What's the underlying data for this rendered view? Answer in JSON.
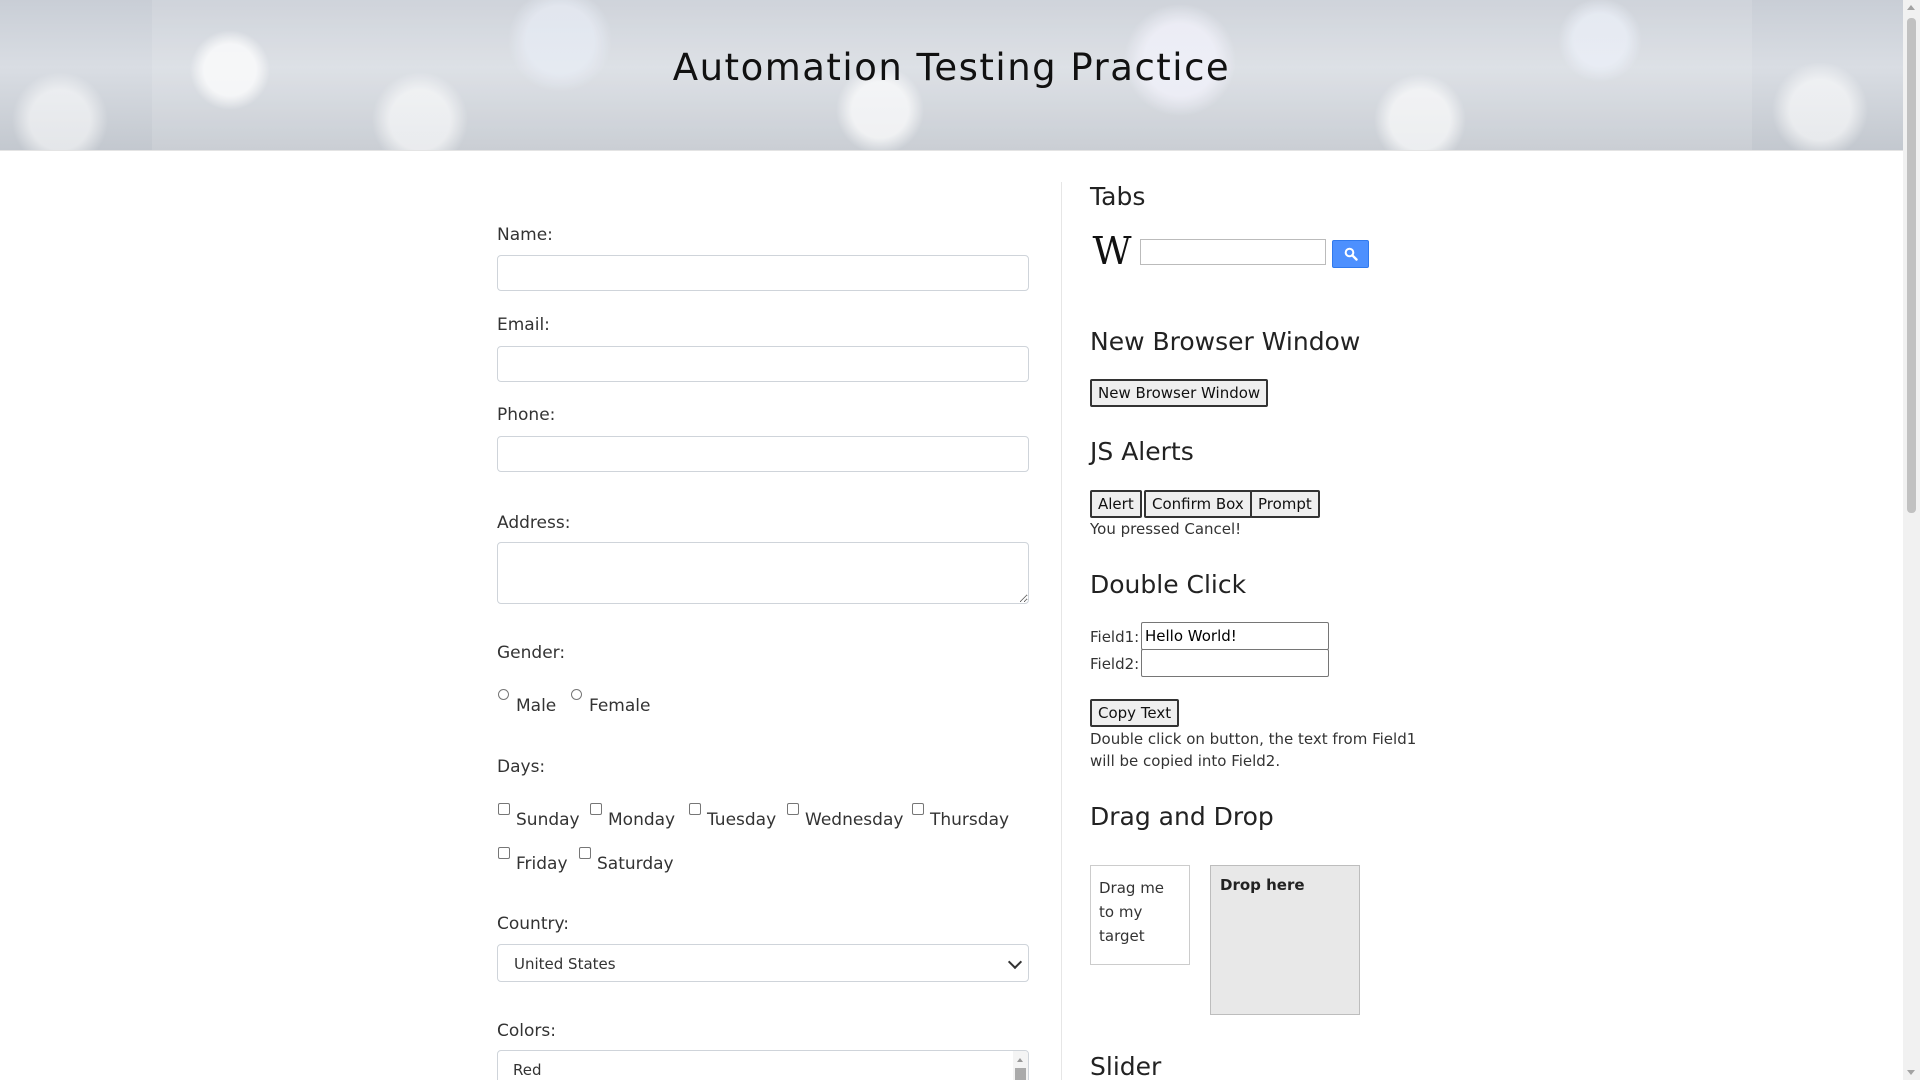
{
  "header": {
    "title": "Automation Testing Practice"
  },
  "form": {
    "name_label": "Name:",
    "name_value": "",
    "email_label": "Email:",
    "email_value": "",
    "phone_label": "Phone:",
    "phone_value": "",
    "address_label": "Address:",
    "address_value": "",
    "gender_label": "Gender:",
    "gender_options": [
      {
        "label": "Male",
        "checked": false
      },
      {
        "label": "Female",
        "checked": false
      }
    ],
    "days_label": "Days:",
    "days": [
      {
        "label": "Sunday",
        "checked": false
      },
      {
        "label": "Monday",
        "checked": false
      },
      {
        "label": "Tuesday",
        "checked": false
      },
      {
        "label": "Wednesday",
        "checked": false
      },
      {
        "label": "Thursday",
        "checked": false
      },
      {
        "label": "Friday",
        "checked": false
      },
      {
        "label": "Saturday",
        "checked": false
      }
    ],
    "country_label": "Country:",
    "country_value": "United States",
    "colors_label": "Colors:",
    "colors_first_item": "Red"
  },
  "tabs": {
    "heading": "Tabs",
    "search_icon": "magnifier-icon",
    "logo_icon": "wikipedia-w-logo"
  },
  "browser_window": {
    "heading": "New Browser Window",
    "button_label": "New Browser Window"
  },
  "alerts": {
    "heading": "JS Alerts",
    "alert_label": "Alert",
    "confirm_label": "Confirm Box",
    "prompt_label": "Prompt",
    "result_text": "You pressed Cancel!"
  },
  "double_click": {
    "heading": "Double Click",
    "field1_label": "Field1:",
    "field1_value": "Hello World!",
    "field2_label": "Field2:",
    "field2_value": "",
    "button_label": "Copy Text",
    "hint_line1": "Double click on button, the text from Field1",
    "hint_line2": "will be copied into Field2."
  },
  "drag_drop": {
    "heading": "Drag and Drop",
    "draggable_text": "Drag me to my target",
    "drop_text": "Drop here"
  },
  "slider": {
    "heading": "Slider"
  },
  "colors": {
    "wiki_button": "#4d90fe",
    "drop_background": "#e8e8e8"
  }
}
